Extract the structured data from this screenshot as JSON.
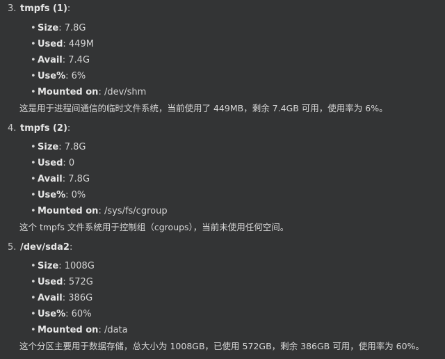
{
  "sections": [
    {
      "number": "3.",
      "title": "tmpfs (1)",
      "colon": ":",
      "items": [
        {
          "key": "Size",
          "value": ": 7.8G"
        },
        {
          "key": "Used",
          "value": ": 449M"
        },
        {
          "key": "Avail",
          "value": ": 7.4G"
        },
        {
          "key": "Use%",
          "value": ": 6%"
        },
        {
          "key": "Mounted on",
          "value": ": /dev/shm"
        }
      ],
      "description": "这是用于进程间通信的临时文件系统，当前使用了 449MB，剩余 7.4GB 可用，使用率为 6%。"
    },
    {
      "number": "4.",
      "title": "tmpfs (2)",
      "colon": ":",
      "items": [
        {
          "key": "Size",
          "value": ": 7.8G"
        },
        {
          "key": "Used",
          "value": ": 0"
        },
        {
          "key": "Avail",
          "value": ": 7.8G"
        },
        {
          "key": "Use%",
          "value": ": 0%"
        },
        {
          "key": "Mounted on",
          "value": ": /sys/fs/cgroup"
        }
      ],
      "description": "这个 tmpfs 文件系统用于控制组（cgroups），当前未使用任何空间。"
    },
    {
      "number": "5.",
      "title": "/dev/sda2",
      "colon": ":",
      "items": [
        {
          "key": "Size",
          "value": ": 1008G"
        },
        {
          "key": "Used",
          "value": ": 572G"
        },
        {
          "key": "Avail",
          "value": ": 386G"
        },
        {
          "key": "Use%",
          "value": ": 60%"
        },
        {
          "key": "Mounted on",
          "value": ": /data"
        }
      ],
      "description": "这个分区主要用于数据存储，总大小为 1008GB，已使用 572GB，剩余 386GB 可用，使用率为 60%。"
    }
  ]
}
